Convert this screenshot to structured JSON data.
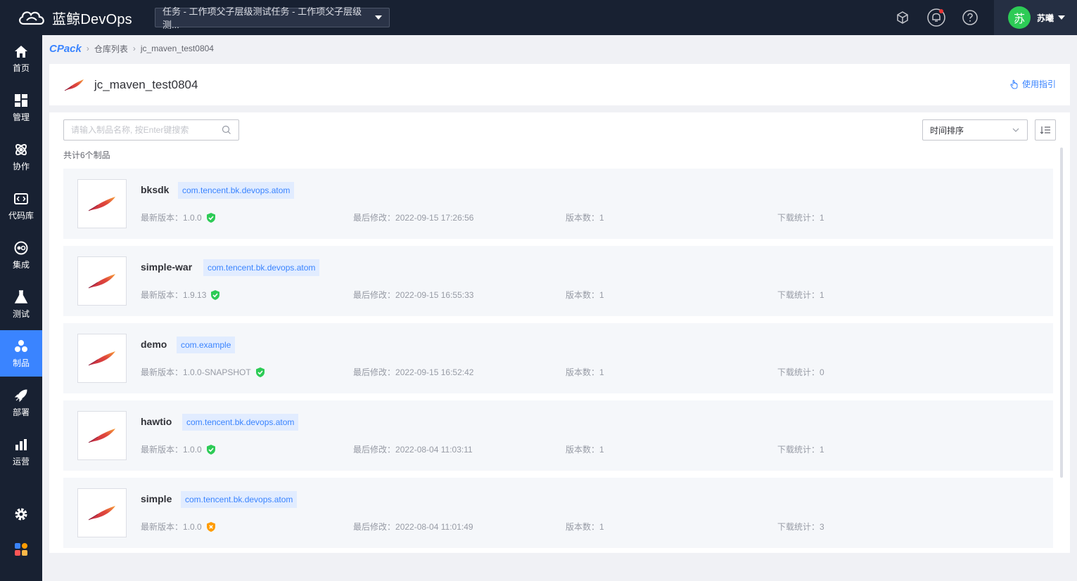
{
  "topbar": {
    "logo_text": "蓝鲸DevOps",
    "project": "任务 - 工作项父子层级测试任务 - 工作项父子层级测...",
    "user_avatar": "苏",
    "user_name": "苏曦"
  },
  "sidenav": {
    "items": [
      {
        "label": "首页",
        "icon": "home-icon"
      },
      {
        "label": "管理",
        "icon": "dashboard-icon"
      },
      {
        "label": "协作",
        "icon": "collab-icon"
      },
      {
        "label": "代码库",
        "icon": "code-icon"
      },
      {
        "label": "集成",
        "icon": "integration-icon"
      },
      {
        "label": "测试",
        "icon": "flask-icon"
      },
      {
        "label": "制品",
        "icon": "artifact-icon"
      },
      {
        "label": "部署",
        "icon": "rocket-icon"
      },
      {
        "label": "运营",
        "icon": "chart-icon"
      }
    ],
    "active": "制品"
  },
  "breadcrumb": {
    "logo": "CPack",
    "items": [
      "仓库列表",
      "jc_maven_test0804"
    ]
  },
  "header": {
    "title": "jc_maven_test0804",
    "guide": "使用指引"
  },
  "toolbar": {
    "search_placeholder": "请输入制品名称, 按Enter键搜索",
    "sort_label": "时间排序"
  },
  "total_text": "共计6个制品",
  "labels": {
    "latest": "最新版本：",
    "modified": "最后修改：",
    "versions": "版本数：",
    "downloads": "下载统计："
  },
  "packages": [
    {
      "name": "bksdk",
      "group": "com.tencent.bk.devops.atom",
      "version": "1.0.0",
      "status": "ok",
      "modified": "2022-09-15 17:26:56",
      "versions": "1",
      "downloads": "1"
    },
    {
      "name": "simple-war",
      "group": "com.tencent.bk.devops.atom",
      "version": "1.9.13",
      "status": "ok",
      "modified": "2022-09-15 16:55:33",
      "versions": "1",
      "downloads": "1"
    },
    {
      "name": "demo",
      "group": "com.example",
      "version": "1.0.0-SNAPSHOT",
      "status": "ok",
      "modified": "2022-09-15 16:52:42",
      "versions": "1",
      "downloads": "0"
    },
    {
      "name": "hawtio",
      "group": "com.tencent.bk.devops.atom",
      "version": "1.0.0",
      "status": "ok",
      "modified": "2022-08-04 11:03:11",
      "versions": "1",
      "downloads": "1"
    },
    {
      "name": "simple",
      "group": "com.tencent.bk.devops.atom",
      "version": "1.0.0",
      "status": "warn",
      "modified": "2022-08-04 11:01:49",
      "versions": "1",
      "downloads": "3"
    }
  ],
  "colors": {
    "accent": "#3a84ff",
    "nav_bg": "#182132",
    "ok": "#2dcb56",
    "warn": "#ff9c01"
  }
}
